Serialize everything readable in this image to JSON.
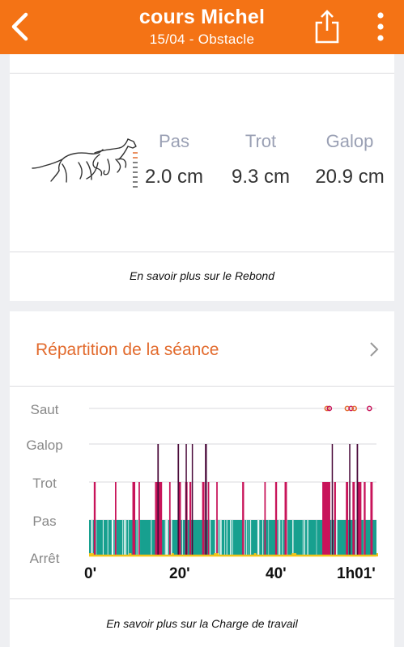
{
  "header": {
    "title": "cours Michel",
    "subtitle": "15/04 - Obstacle",
    "color": "#f47315"
  },
  "rebond": {
    "columns": [
      {
        "label": "Pas",
        "value": "2.0 cm"
      },
      {
        "label": "Trot",
        "value": "9.3 cm"
      },
      {
        "label": "Galop",
        "value": "20.9 cm"
      }
    ],
    "link": "En savoir plus sur le Rebond",
    "icon": "horse-gallop-icon"
  },
  "repartition": {
    "title": "Répartition de la séance",
    "link": "En savoir plus sur la Charge de travail",
    "accent": "#e26a2c"
  },
  "chart_data": {
    "type": "timeline",
    "y_categories": [
      "Saut",
      "Galop",
      "Trot",
      "Pas",
      "Arrêt"
    ],
    "x_ticks": [
      "0'",
      "20'",
      "40'",
      "1h01'"
    ],
    "x_range_minutes": [
      0,
      61
    ],
    "colors": {
      "pas": "#17a08f",
      "trot": "#c8145a",
      "galop": "#4a0a3a",
      "arret": "#f2c418",
      "saut": "#c8145a"
    },
    "jumps_minutes": [
      50.5,
      51.0,
      54.8,
      55.6,
      56.3,
      59.5
    ],
    "trot_segments": [
      [
        1.0,
        1.4
      ],
      [
        5.5,
        5.8
      ],
      [
        9.2,
        9.8
      ],
      [
        10.5,
        10.8
      ],
      [
        14.0,
        15.5
      ],
      [
        17.0,
        17.3
      ],
      [
        19.0,
        19.5
      ],
      [
        20.4,
        20.9
      ],
      [
        21.3,
        21.7
      ],
      [
        24.0,
        24.5
      ],
      [
        25.2,
        25.5
      ],
      [
        27.0,
        27.3
      ],
      [
        32.5,
        32.9
      ],
      [
        37.2,
        37.5
      ],
      [
        39.5,
        39.9
      ],
      [
        41.5,
        42.0
      ],
      [
        49.5,
        51.2
      ],
      [
        52.0,
        52.4
      ],
      [
        54.5,
        55.0
      ],
      [
        55.9,
        56.4
      ],
      [
        57.0,
        57.8
      ],
      [
        58.3,
        58.7
      ],
      [
        59.7,
        60.2
      ]
    ],
    "galop_segments": [
      [
        14.5,
        14.8
      ],
      [
        18.8,
        19.1
      ],
      [
        20.5,
        20.7
      ],
      [
        21.8,
        22.0
      ],
      [
        24.6,
        25.0
      ],
      [
        51.5,
        51.7
      ],
      [
        55.2,
        55.4
      ],
      [
        56.8,
        57.1
      ]
    ],
    "arret_segments": [
      [
        0,
        1.0
      ],
      [
        8.5,
        9.0
      ],
      [
        17.5,
        18.0
      ],
      [
        26.5,
        27.5
      ],
      [
        35.0,
        35.5
      ],
      [
        43.0,
        44.0
      ],
      [
        61.0,
        61.5
      ]
    ]
  }
}
